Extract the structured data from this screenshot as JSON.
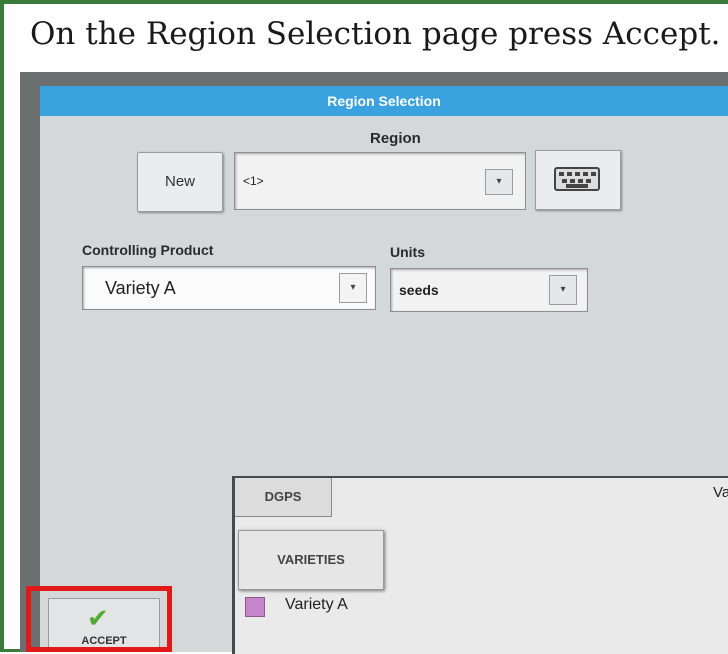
{
  "instruction": "On the Region Selection page press Accept.",
  "dialog": {
    "title": "Region Selection",
    "region_label": "Region",
    "new_button": "New",
    "region_value": "<1>",
    "controlling_product_label": "Controlling Product",
    "controlling_product_value": "Variety A",
    "units_label": "Units",
    "units_value": "seeds",
    "accept_button": "ACCEPT"
  },
  "overlay": {
    "tab_label": "DGPS",
    "header_text": "Varie",
    "varieties_button": "VARIETIES",
    "legend_item": "Variety A",
    "legend_color": "#c586c9"
  },
  "icons": {
    "dropdown_arrow": "chevron-down-icon",
    "keyboard": "keyboard-icon",
    "accept_check": "checkmark-icon"
  },
  "colors": {
    "title_bar": "#3aa2df",
    "highlight_box": "#e11919",
    "frame_border": "#3c7a3c"
  }
}
